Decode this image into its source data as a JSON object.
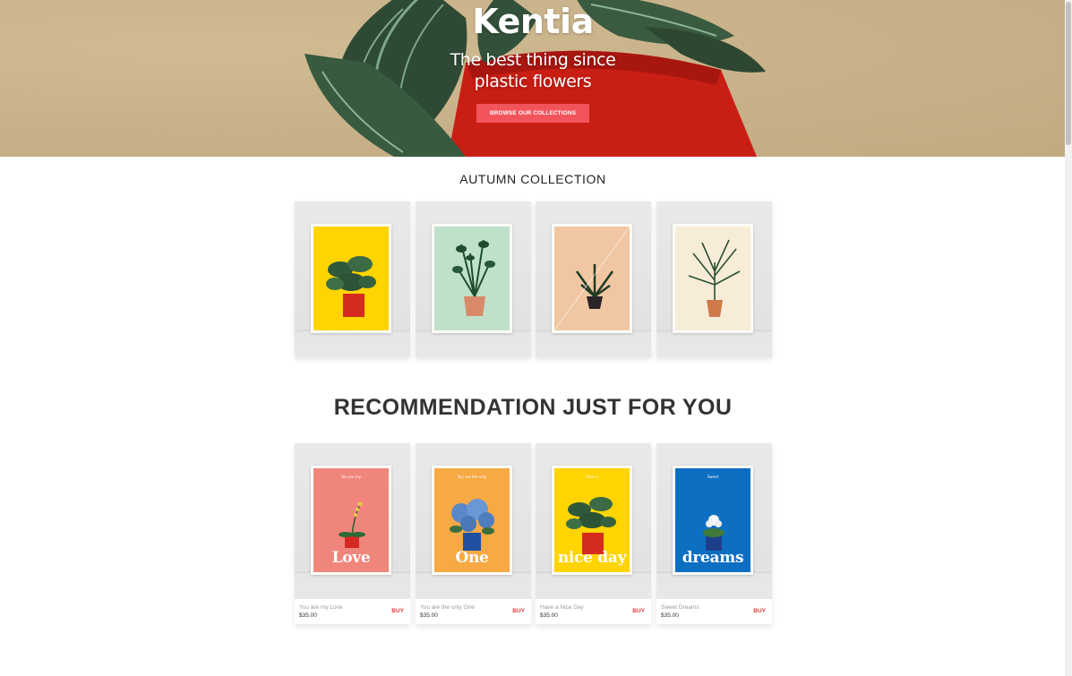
{
  "hero": {
    "title": "Kentia",
    "subtitle_line1": "The best thing since",
    "subtitle_line2": "plastic flowers",
    "cta_label": "BROWSE OUR COLLECTIONS"
  },
  "autumn": {
    "title": "AUTUMN COLLECTION",
    "items": [
      {
        "poster_color": "#ffd400",
        "plant": "calathea",
        "pot": "#d52b1e"
      },
      {
        "poster_color": "#bfe0c9",
        "plant": "zz-plant",
        "pot": "#d98a6a"
      },
      {
        "poster_color": "#f1c7a3",
        "plant": "palm-small",
        "pot": "#2a2328"
      },
      {
        "poster_color": "#f7ecd8",
        "plant": "kentia-palm",
        "pot": "#d07a4c"
      }
    ]
  },
  "recommendations": {
    "title": "RECOMMENDATION JUST FOR YOU",
    "buy_label": "BUY",
    "items": [
      {
        "small_text": "You are my",
        "big_text": "Love",
        "name": "You are my Love",
        "price": "$35.00",
        "poster_color": "#f0857c",
        "plant": "orchid",
        "pot": "#d42a22"
      },
      {
        "small_text": "You are the only",
        "big_text": "One",
        "name": "You are the only One",
        "price": "$35.00",
        "poster_color": "#f7a944",
        "plant": "hydrangea",
        "pot": "#234fa0"
      },
      {
        "small_text": "Have a",
        "big_text": "nice day",
        "name": "Have a Nice Day",
        "price": "$35.00",
        "poster_color": "#ffd400",
        "plant": "calathea",
        "pot": "#d52b1e"
      },
      {
        "small_text": "Sweet",
        "big_text": "dreams",
        "name": "Sweet Dreams",
        "price": "$35.00",
        "poster_color": "#0d6fc2",
        "plant": "white-flower",
        "pot": "#1d3f8a"
      }
    ]
  }
}
